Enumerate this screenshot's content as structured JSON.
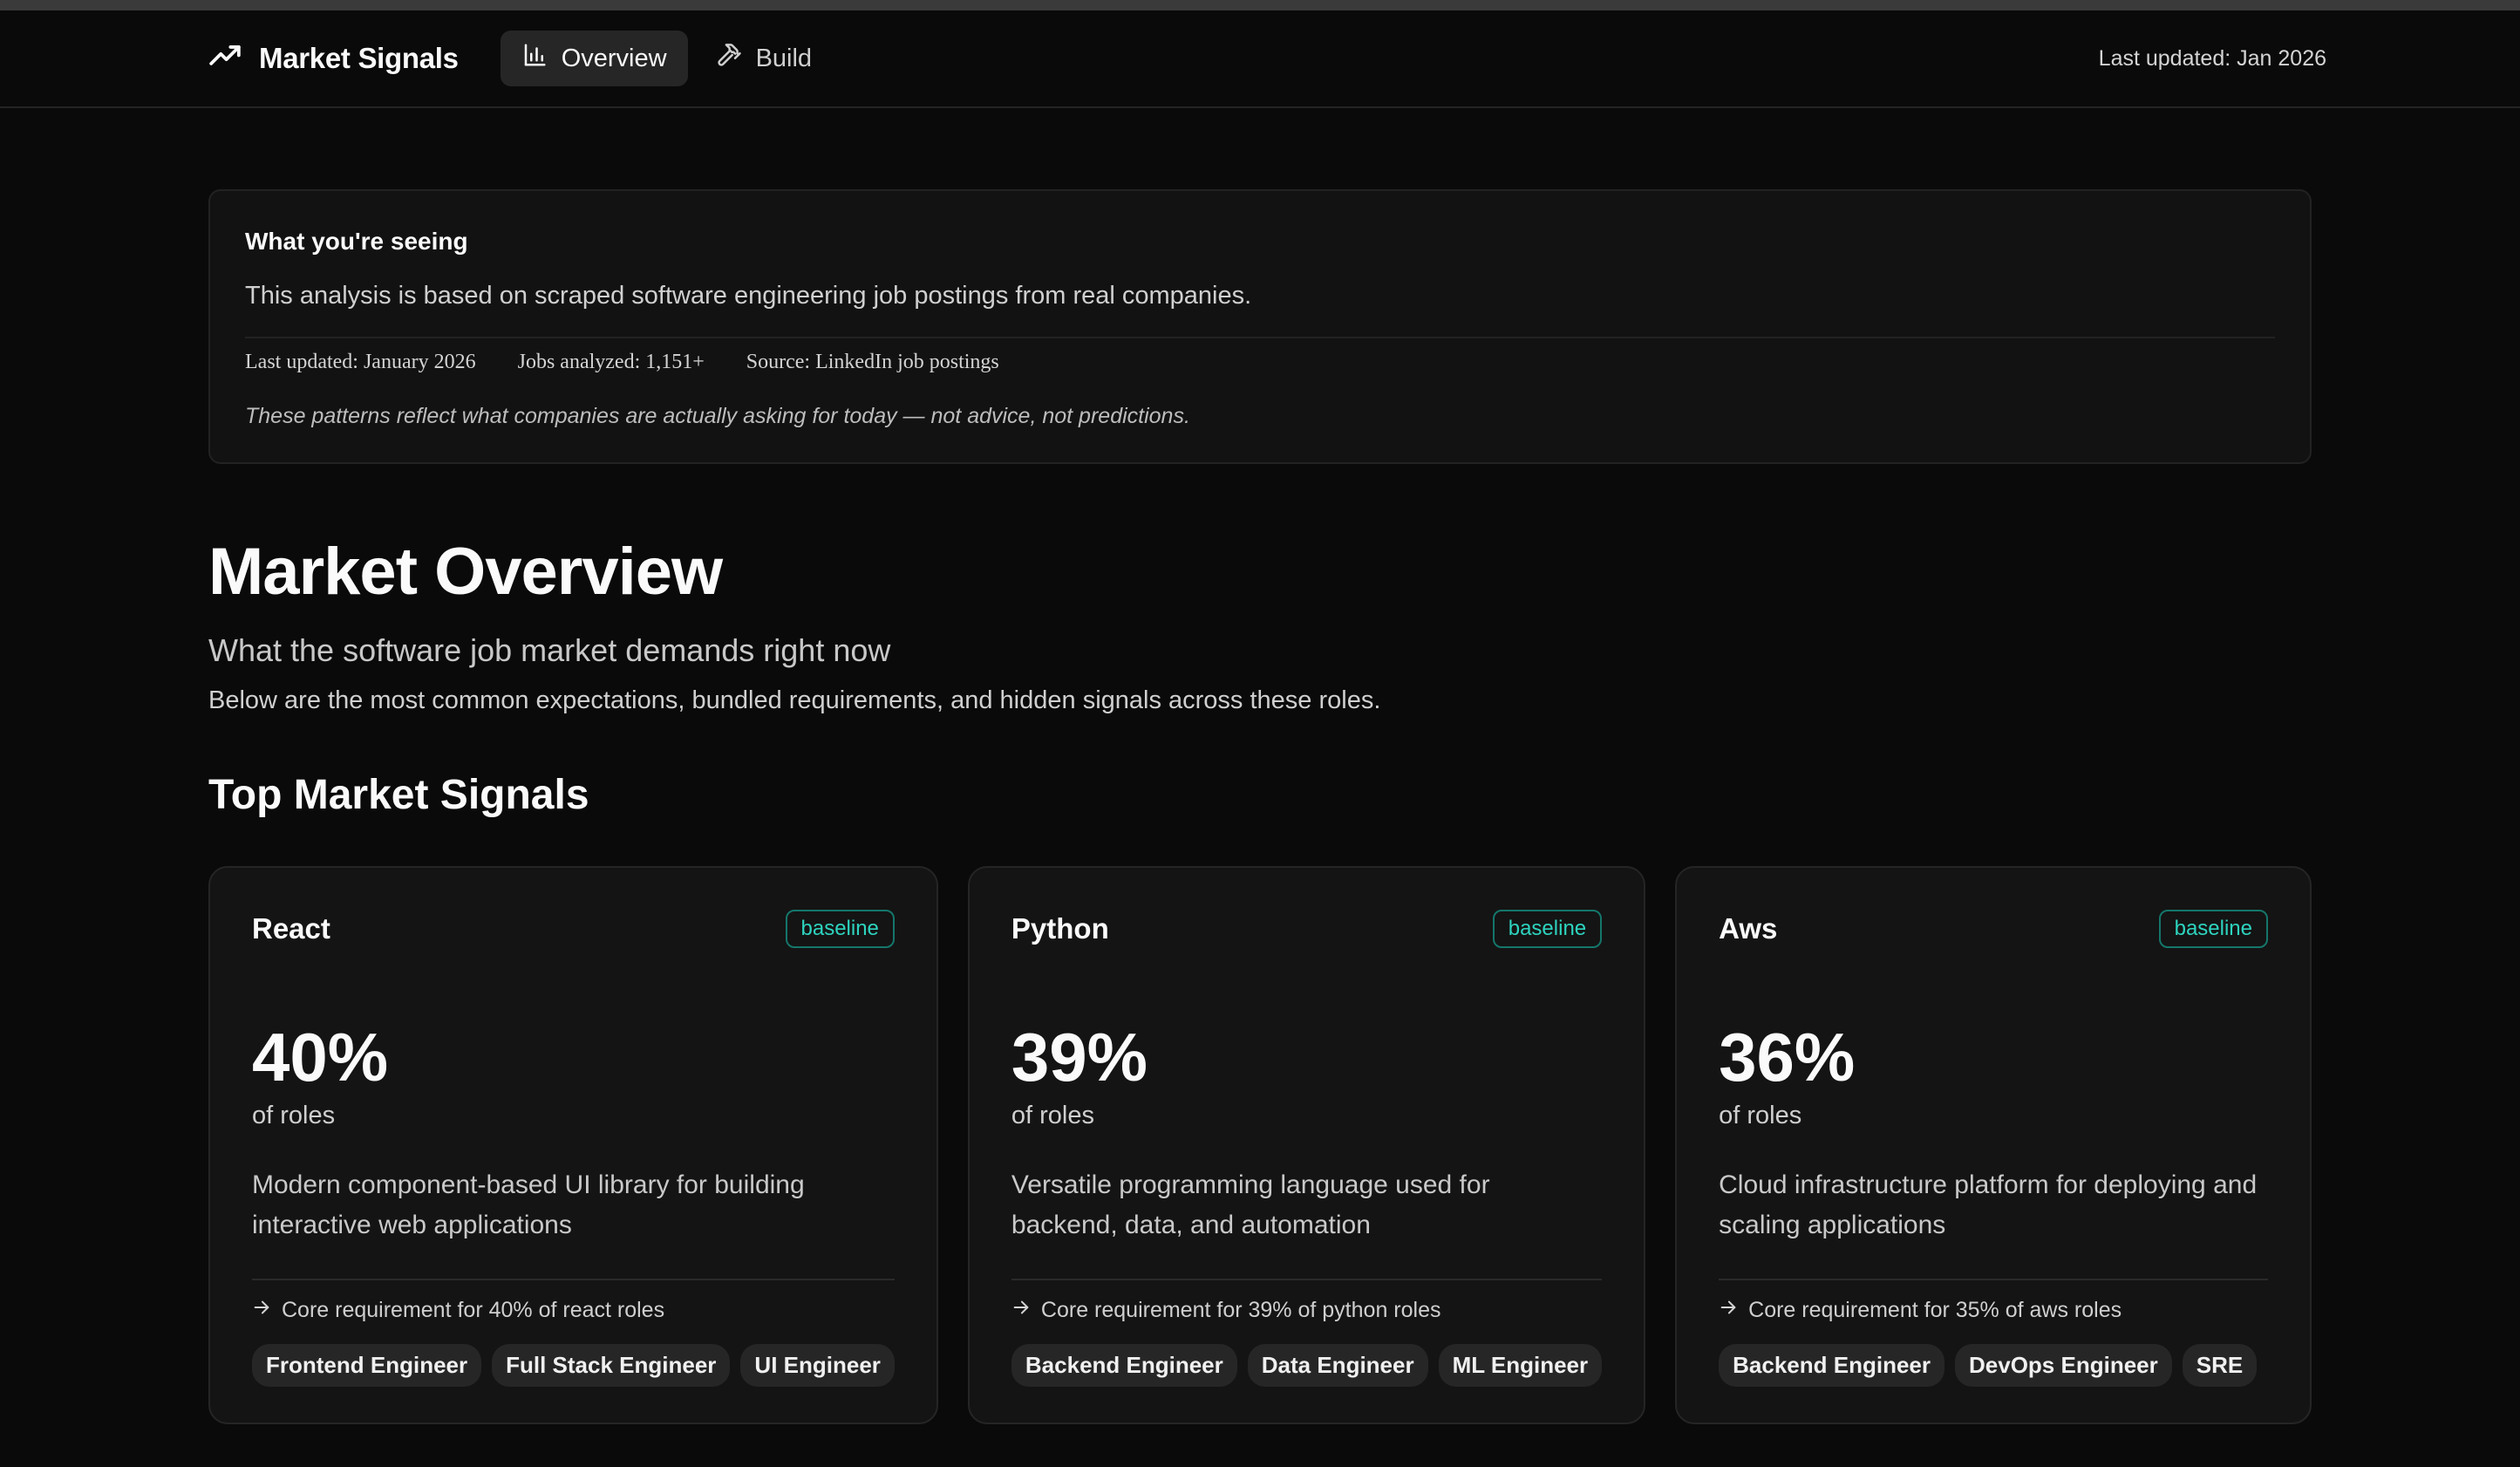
{
  "header": {
    "brand": "Market Signals",
    "brand_icon": "trending-up-icon",
    "nav": [
      {
        "label": "Overview",
        "icon": "bar-chart-icon",
        "active": true
      },
      {
        "label": "Build",
        "icon": "hammer-icon",
        "active": false
      }
    ],
    "last_updated": "Last updated: Jan 2026"
  },
  "info": {
    "title": "What you're seeing",
    "description": "This analysis is based on scraped software engineering job postings from real companies.",
    "meta": {
      "updated": "Last updated: January 2026",
      "jobs": "Jobs analyzed: 1,151+",
      "source": "Source: LinkedIn job postings"
    },
    "note": "These patterns reflect what companies are actually asking for today — not advice, not predictions."
  },
  "page": {
    "title": "Market Overview",
    "subtitle": "What the software job market demands right now",
    "description": "Below are the most common expectations, bundled requirements, and hidden signals across these roles."
  },
  "section": {
    "title": "Top Market Signals"
  },
  "colors": {
    "accent": "#2dd4bf",
    "background": "#0a0a0a",
    "card": "#141414"
  },
  "cards": [
    {
      "name": "React",
      "badge": "baseline",
      "percent": "40%",
      "unit": "of roles",
      "description": "Modern component-based UI library for building interactive web applications",
      "note": "Core requirement for 40% of react roles",
      "tags": [
        "Frontend Engineer",
        "Full Stack Engineer",
        "UI Engineer"
      ]
    },
    {
      "name": "Python",
      "badge": "baseline",
      "percent": "39%",
      "unit": "of roles",
      "description": "Versatile programming language used for backend, data, and automation",
      "note": "Core requirement for 39% of python roles",
      "tags": [
        "Backend Engineer",
        "Data Engineer",
        "ML Engineer"
      ]
    },
    {
      "name": "Aws",
      "badge": "baseline",
      "percent": "36%",
      "unit": "of roles",
      "description": "Cloud infrastructure platform for deploying and scaling applications",
      "note": "Core requirement for 35% of aws roles",
      "tags": [
        "Backend Engineer",
        "DevOps Engineer",
        "SRE"
      ]
    }
  ]
}
